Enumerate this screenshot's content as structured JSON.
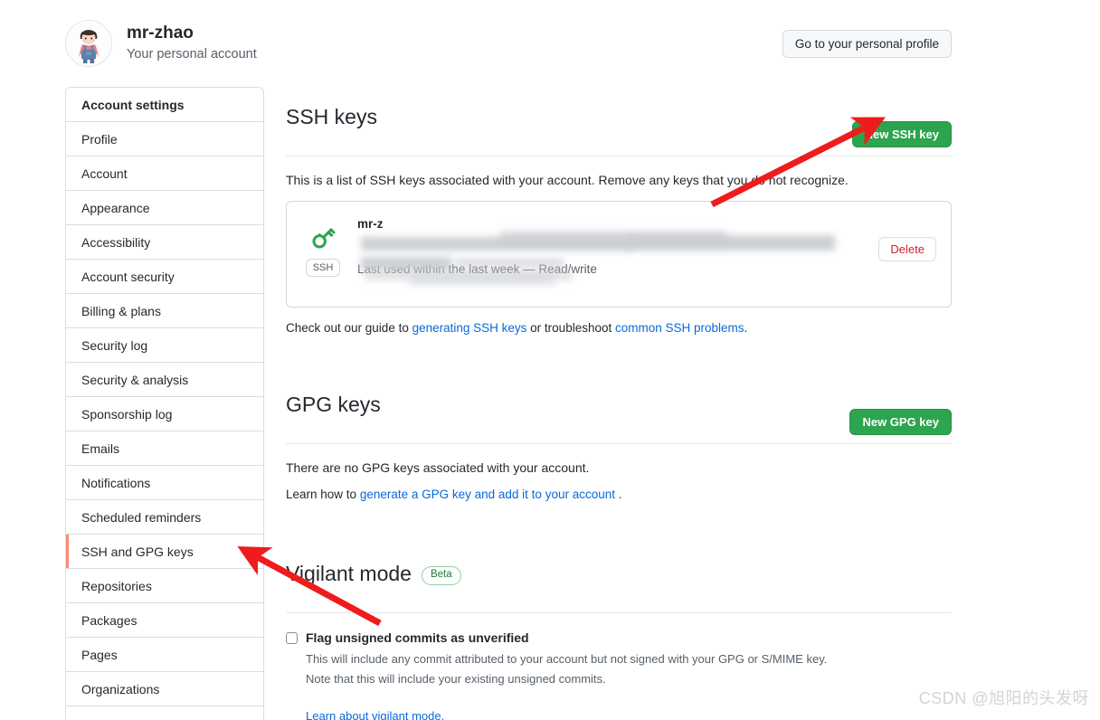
{
  "account": {
    "name": "mr-zhao",
    "subtitle": "Your personal account",
    "profile_button": "Go to your personal profile",
    "avatar_icon": "user-avatar-cartoon"
  },
  "sidebar": {
    "items": [
      {
        "label": "Account settings",
        "heading": true,
        "active": false
      },
      {
        "label": "Profile",
        "heading": false,
        "active": false
      },
      {
        "label": "Account",
        "heading": false,
        "active": false
      },
      {
        "label": "Appearance",
        "heading": false,
        "active": false
      },
      {
        "label": "Accessibility",
        "heading": false,
        "active": false
      },
      {
        "label": "Account security",
        "heading": false,
        "active": false
      },
      {
        "label": "Billing & plans",
        "heading": false,
        "active": false
      },
      {
        "label": "Security log",
        "heading": false,
        "active": false
      },
      {
        "label": "Security & analysis",
        "heading": false,
        "active": false
      },
      {
        "label": "Sponsorship log",
        "heading": false,
        "active": false
      },
      {
        "label": "Emails",
        "heading": false,
        "active": false
      },
      {
        "label": "Notifications",
        "heading": false,
        "active": false
      },
      {
        "label": "Scheduled reminders",
        "heading": false,
        "active": false
      },
      {
        "label": "SSH and GPG keys",
        "heading": false,
        "active": true
      },
      {
        "label": "Repositories",
        "heading": false,
        "active": false
      },
      {
        "label": "Packages",
        "heading": false,
        "active": false
      },
      {
        "label": "Pages",
        "heading": false,
        "active": false
      },
      {
        "label": "Organizations",
        "heading": false,
        "active": false
      }
    ],
    "active_marker_color": "#fd8c73"
  },
  "ssh_section": {
    "title": "SSH keys",
    "new_button": "New SSH key",
    "description": "This is a list of SSH keys associated with your account. Remove any keys that you do not recognize.",
    "key": {
      "title": "mr-z",
      "type_badge": "SSH",
      "fingerprint": "",
      "meta": "Last used within the last week — Read/write",
      "delete_button": "Delete",
      "icon": "key-icon"
    },
    "footer": {
      "prefix": "Check out our guide to ",
      "link1": "generating SSH keys",
      "middle": " or troubleshoot ",
      "link2": "common SSH problems",
      "suffix": "."
    }
  },
  "gpg_section": {
    "title": "GPG keys",
    "new_button": "New GPG key",
    "empty_text": "There are no GPG keys associated with your account.",
    "learn": {
      "prefix": "Learn how to ",
      "link": "generate a GPG key and add it to your account",
      "suffix": " ."
    }
  },
  "vigilant_section": {
    "title": "Vigilant mode",
    "badge": "Beta",
    "checkbox_label": "Flag unsigned commits as unverified",
    "checkbox_checked": false,
    "help_line1": "This will include any commit attributed to your account but not signed with your GPG or S/MIME key.",
    "help_line2": "Note that this will include your existing unsigned commits.",
    "learn_link": "Learn about vigilant mode."
  },
  "annotations": {
    "arrow_color": "#ee1c1c",
    "arrow_count": 2
  },
  "watermark": "CSDN @旭阳的头发呀",
  "colors": {
    "green_button": "#2da44e",
    "link": "#0969da",
    "delete_text": "#cf222e",
    "active_border": "#fd8c73",
    "key_icon": "#2da44e"
  }
}
